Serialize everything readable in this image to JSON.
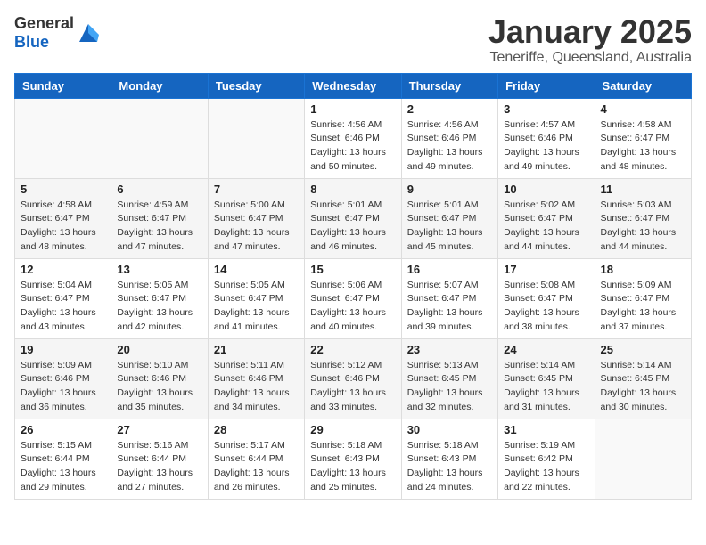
{
  "header": {
    "logo_general": "General",
    "logo_blue": "Blue",
    "month": "January 2025",
    "location": "Teneriffe, Queensland, Australia"
  },
  "weekdays": [
    "Sunday",
    "Monday",
    "Tuesday",
    "Wednesday",
    "Thursday",
    "Friday",
    "Saturday"
  ],
  "weeks": [
    [
      {
        "day": "",
        "sunrise": "",
        "sunset": "",
        "daylight": ""
      },
      {
        "day": "",
        "sunrise": "",
        "sunset": "",
        "daylight": ""
      },
      {
        "day": "",
        "sunrise": "",
        "sunset": "",
        "daylight": ""
      },
      {
        "day": "1",
        "sunrise": "Sunrise: 4:56 AM",
        "sunset": "Sunset: 6:46 PM",
        "daylight": "Daylight: 13 hours and 50 minutes."
      },
      {
        "day": "2",
        "sunrise": "Sunrise: 4:56 AM",
        "sunset": "Sunset: 6:46 PM",
        "daylight": "Daylight: 13 hours and 49 minutes."
      },
      {
        "day": "3",
        "sunrise": "Sunrise: 4:57 AM",
        "sunset": "Sunset: 6:46 PM",
        "daylight": "Daylight: 13 hours and 49 minutes."
      },
      {
        "day": "4",
        "sunrise": "Sunrise: 4:58 AM",
        "sunset": "Sunset: 6:47 PM",
        "daylight": "Daylight: 13 hours and 48 minutes."
      }
    ],
    [
      {
        "day": "5",
        "sunrise": "Sunrise: 4:58 AM",
        "sunset": "Sunset: 6:47 PM",
        "daylight": "Daylight: 13 hours and 48 minutes."
      },
      {
        "day": "6",
        "sunrise": "Sunrise: 4:59 AM",
        "sunset": "Sunset: 6:47 PM",
        "daylight": "Daylight: 13 hours and 47 minutes."
      },
      {
        "day": "7",
        "sunrise": "Sunrise: 5:00 AM",
        "sunset": "Sunset: 6:47 PM",
        "daylight": "Daylight: 13 hours and 47 minutes."
      },
      {
        "day": "8",
        "sunrise": "Sunrise: 5:01 AM",
        "sunset": "Sunset: 6:47 PM",
        "daylight": "Daylight: 13 hours and 46 minutes."
      },
      {
        "day": "9",
        "sunrise": "Sunrise: 5:01 AM",
        "sunset": "Sunset: 6:47 PM",
        "daylight": "Daylight: 13 hours and 45 minutes."
      },
      {
        "day": "10",
        "sunrise": "Sunrise: 5:02 AM",
        "sunset": "Sunset: 6:47 PM",
        "daylight": "Daylight: 13 hours and 44 minutes."
      },
      {
        "day": "11",
        "sunrise": "Sunrise: 5:03 AM",
        "sunset": "Sunset: 6:47 PM",
        "daylight": "Daylight: 13 hours and 44 minutes."
      }
    ],
    [
      {
        "day": "12",
        "sunrise": "Sunrise: 5:04 AM",
        "sunset": "Sunset: 6:47 PM",
        "daylight": "Daylight: 13 hours and 43 minutes."
      },
      {
        "day": "13",
        "sunrise": "Sunrise: 5:05 AM",
        "sunset": "Sunset: 6:47 PM",
        "daylight": "Daylight: 13 hours and 42 minutes."
      },
      {
        "day": "14",
        "sunrise": "Sunrise: 5:05 AM",
        "sunset": "Sunset: 6:47 PM",
        "daylight": "Daylight: 13 hours and 41 minutes."
      },
      {
        "day": "15",
        "sunrise": "Sunrise: 5:06 AM",
        "sunset": "Sunset: 6:47 PM",
        "daylight": "Daylight: 13 hours and 40 minutes."
      },
      {
        "day": "16",
        "sunrise": "Sunrise: 5:07 AM",
        "sunset": "Sunset: 6:47 PM",
        "daylight": "Daylight: 13 hours and 39 minutes."
      },
      {
        "day": "17",
        "sunrise": "Sunrise: 5:08 AM",
        "sunset": "Sunset: 6:47 PM",
        "daylight": "Daylight: 13 hours and 38 minutes."
      },
      {
        "day": "18",
        "sunrise": "Sunrise: 5:09 AM",
        "sunset": "Sunset: 6:47 PM",
        "daylight": "Daylight: 13 hours and 37 minutes."
      }
    ],
    [
      {
        "day": "19",
        "sunrise": "Sunrise: 5:09 AM",
        "sunset": "Sunset: 6:46 PM",
        "daylight": "Daylight: 13 hours and 36 minutes."
      },
      {
        "day": "20",
        "sunrise": "Sunrise: 5:10 AM",
        "sunset": "Sunset: 6:46 PM",
        "daylight": "Daylight: 13 hours and 35 minutes."
      },
      {
        "day": "21",
        "sunrise": "Sunrise: 5:11 AM",
        "sunset": "Sunset: 6:46 PM",
        "daylight": "Daylight: 13 hours and 34 minutes."
      },
      {
        "day": "22",
        "sunrise": "Sunrise: 5:12 AM",
        "sunset": "Sunset: 6:46 PM",
        "daylight": "Daylight: 13 hours and 33 minutes."
      },
      {
        "day": "23",
        "sunrise": "Sunrise: 5:13 AM",
        "sunset": "Sunset: 6:45 PM",
        "daylight": "Daylight: 13 hours and 32 minutes."
      },
      {
        "day": "24",
        "sunrise": "Sunrise: 5:14 AM",
        "sunset": "Sunset: 6:45 PM",
        "daylight": "Daylight: 13 hours and 31 minutes."
      },
      {
        "day": "25",
        "sunrise": "Sunrise: 5:14 AM",
        "sunset": "Sunset: 6:45 PM",
        "daylight": "Daylight: 13 hours and 30 minutes."
      }
    ],
    [
      {
        "day": "26",
        "sunrise": "Sunrise: 5:15 AM",
        "sunset": "Sunset: 6:44 PM",
        "daylight": "Daylight: 13 hours and 29 minutes."
      },
      {
        "day": "27",
        "sunrise": "Sunrise: 5:16 AM",
        "sunset": "Sunset: 6:44 PM",
        "daylight": "Daylight: 13 hours and 27 minutes."
      },
      {
        "day": "28",
        "sunrise": "Sunrise: 5:17 AM",
        "sunset": "Sunset: 6:44 PM",
        "daylight": "Daylight: 13 hours and 26 minutes."
      },
      {
        "day": "29",
        "sunrise": "Sunrise: 5:18 AM",
        "sunset": "Sunset: 6:43 PM",
        "daylight": "Daylight: 13 hours and 25 minutes."
      },
      {
        "day": "30",
        "sunrise": "Sunrise: 5:18 AM",
        "sunset": "Sunset: 6:43 PM",
        "daylight": "Daylight: 13 hours and 24 minutes."
      },
      {
        "day": "31",
        "sunrise": "Sunrise: 5:19 AM",
        "sunset": "Sunset: 6:42 PM",
        "daylight": "Daylight: 13 hours and 22 minutes."
      },
      {
        "day": "",
        "sunrise": "",
        "sunset": "",
        "daylight": ""
      }
    ]
  ]
}
